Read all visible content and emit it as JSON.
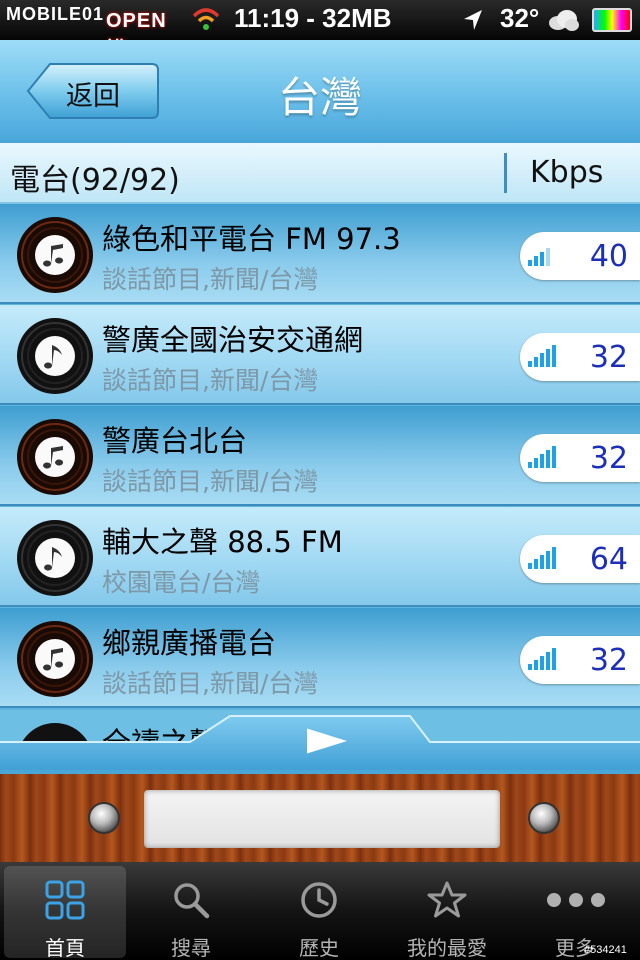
{
  "status_bar": {
    "carrier": "MOBILE01",
    "carrier_badge": "OPEN講",
    "time_memory": "11:19 - 32MB",
    "temperature": "32°"
  },
  "nav": {
    "back_label": "返回",
    "title": "台灣"
  },
  "list_header": {
    "title": "電台(92/92)",
    "rate_header": "Kbps"
  },
  "stations": [
    {
      "name": "綠色和平電台 FM 97.3",
      "category": "談話節目,新聞/台灣",
      "kbps": "40",
      "signal": 3
    },
    {
      "name": "警廣全國治安交通網",
      "category": "談話節目,新聞/台灣",
      "kbps": "32",
      "signal": 4
    },
    {
      "name": "警廣台北台",
      "category": "談話節目,新聞/台灣",
      "kbps": "32",
      "signal": 4
    },
    {
      "name": "輔大之聲 88.5 FM",
      "category": "校園電台/台灣",
      "kbps": "64",
      "signal": 4
    },
    {
      "name": "鄉親廣播電台",
      "category": "談話節目,新聞/台灣",
      "kbps": "32",
      "signal": 4
    }
  ],
  "partial_station": {
    "name": "全禱之聲"
  },
  "player": {
    "play_icon": "play-icon"
  },
  "tabs": [
    {
      "label": "首頁",
      "icon": "home-grid-icon",
      "active": true
    },
    {
      "label": "搜尋",
      "icon": "search-icon",
      "active": false
    },
    {
      "label": "歷史",
      "icon": "clock-icon",
      "active": false
    },
    {
      "label": "我的最愛",
      "icon": "star-icon",
      "active": false
    },
    {
      "label": "更多",
      "icon": "more-dots-icon",
      "active": false
    }
  ],
  "watermark": "#534241",
  "colors": {
    "nav_gradient_top": "#9fdcf6",
    "nav_gradient_bottom": "#4ba8db",
    "rate_text": "#1b2fb8",
    "signal_blue": "#1da1e8"
  }
}
